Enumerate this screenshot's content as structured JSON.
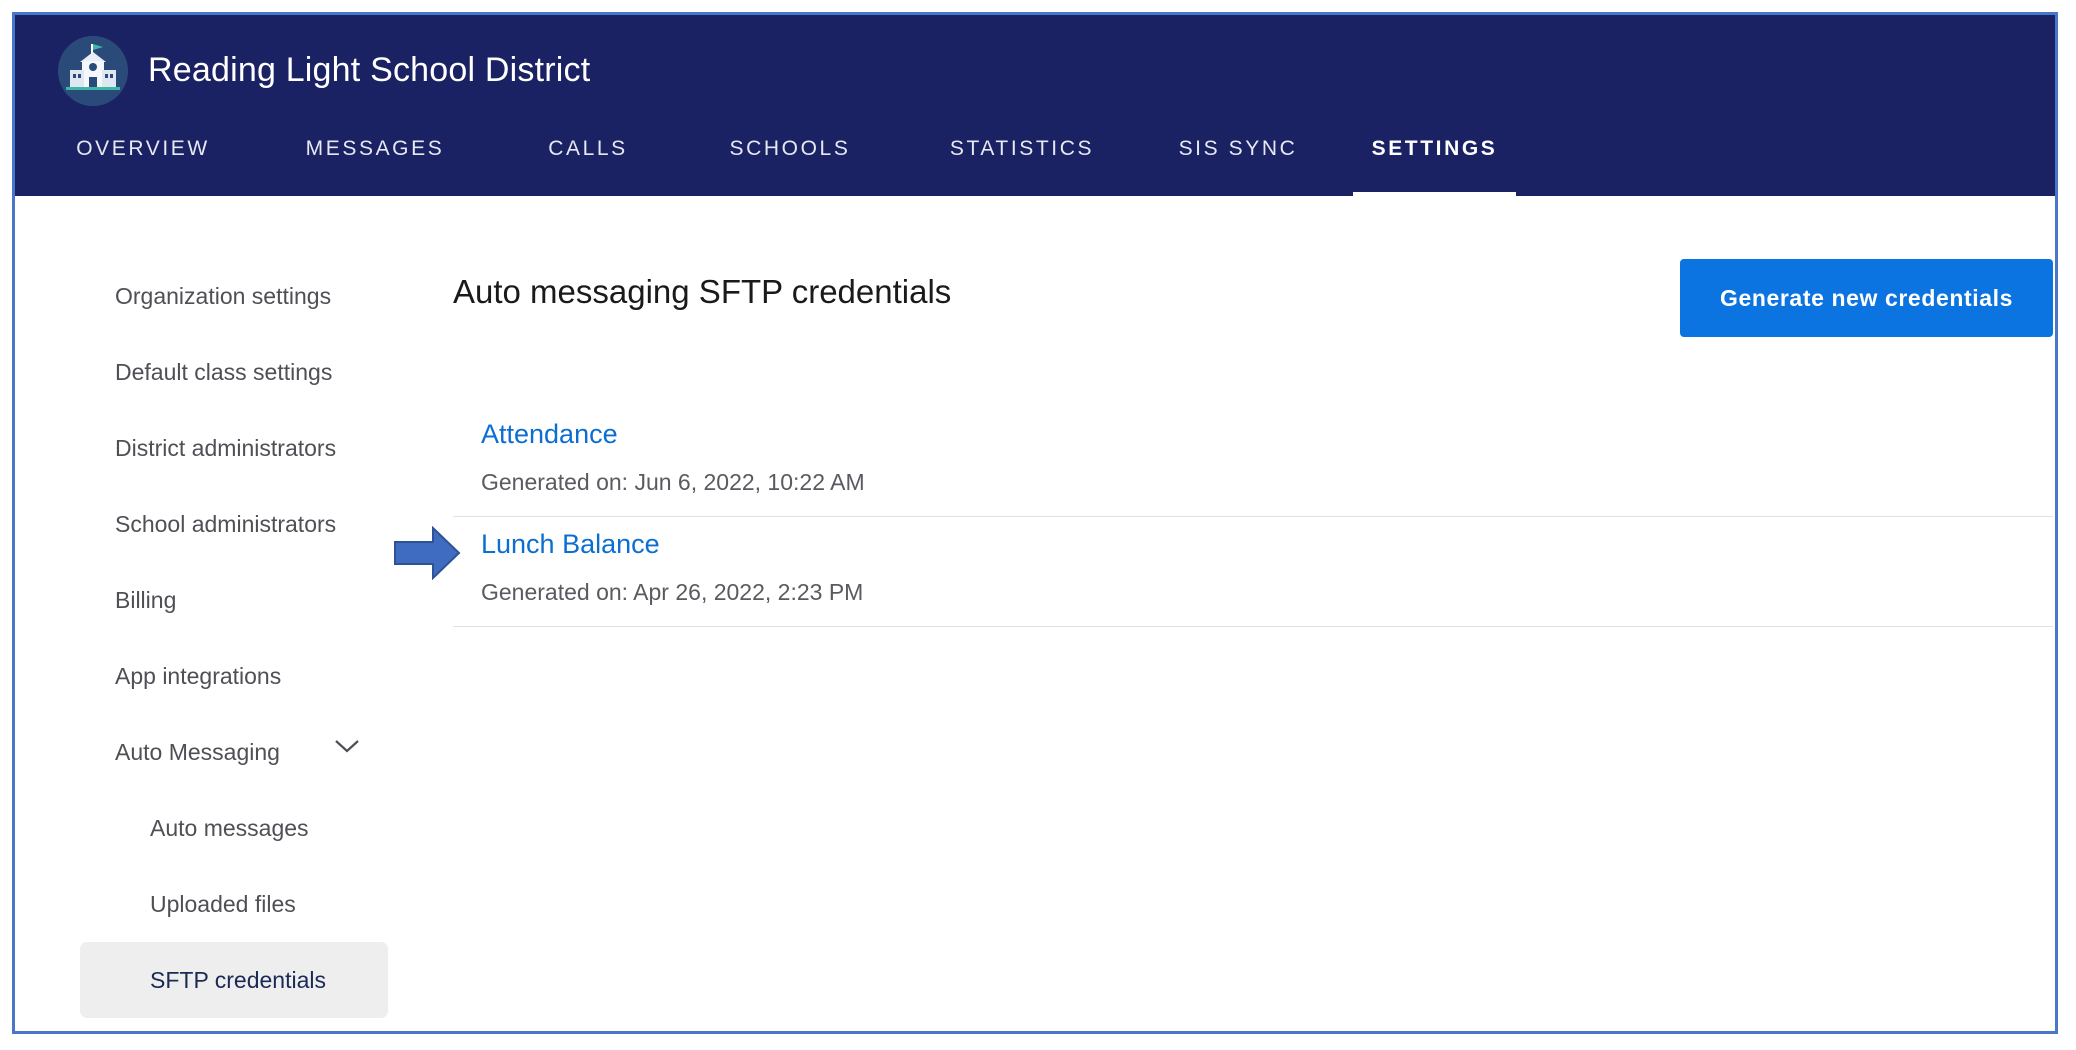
{
  "header": {
    "org_name": "Reading Light School District",
    "logo_icon": "school-building-icon"
  },
  "nav": {
    "tabs": [
      {
        "label": "OVERVIEW"
      },
      {
        "label": "MESSAGES"
      },
      {
        "label": "CALLS"
      },
      {
        "label": "SCHOOLS"
      },
      {
        "label": "STATISTICS"
      },
      {
        "label": "SIS SYNC"
      },
      {
        "label": "SETTINGS",
        "active": true
      }
    ]
  },
  "sidebar": {
    "items": [
      {
        "label": "Organization settings"
      },
      {
        "label": "Default class settings"
      },
      {
        "label": "District administrators"
      },
      {
        "label": "School administrators"
      },
      {
        "label": "Billing"
      },
      {
        "label": "App integrations"
      },
      {
        "label": "Auto Messaging",
        "expanded": true
      },
      {
        "label": "Auto messages"
      },
      {
        "label": "Uploaded files"
      },
      {
        "label": "SFTP credentials",
        "selected": true
      }
    ]
  },
  "main": {
    "heading": "Auto messaging SFTP credentials",
    "generate_button": "Generate new credentials",
    "credentials": [
      {
        "name": "Attendance",
        "generated": "Generated on: Jun 6, 2022, 10:22 AM"
      },
      {
        "name": "Lunch Balance",
        "generated": "Generated on: Apr 26, 2022, 2:23 PM"
      }
    ]
  },
  "colors": {
    "header_bg": "#1b2263",
    "accent": "#0b74e0",
    "link": "#0b6fd1",
    "callout_arrow": "#3f6cc0"
  }
}
